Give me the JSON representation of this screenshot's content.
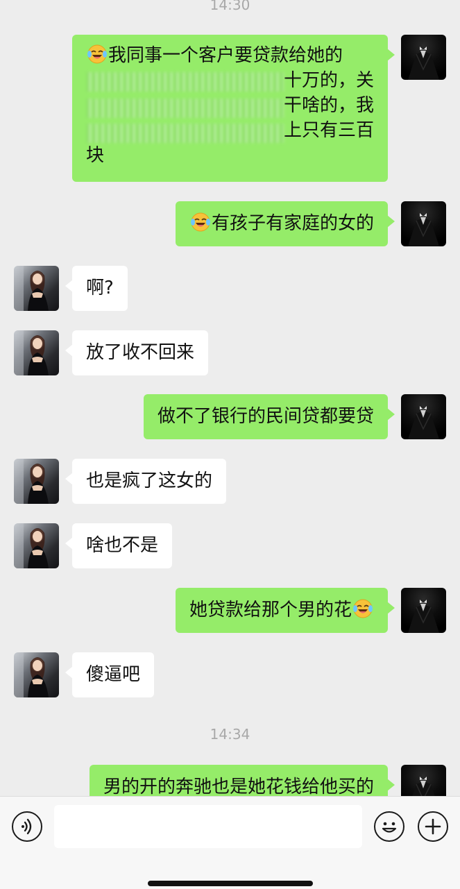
{
  "chat": {
    "timestamps": [
      "14:30",
      "14:34"
    ],
    "messages": [
      {
        "from": "me",
        "lines": [
          "我同事一个客户要贷款给她的",
          "十万的，关",
          "干啥的，我",
          "上只有三百",
          "块"
        ],
        "leading_emoji": "crying-laughing-emoji"
      },
      {
        "from": "me",
        "text": "有孩子有家庭的女的",
        "leading_emoji": "crying-laughing-emoji"
      },
      {
        "from": "peer",
        "text": "啊?"
      },
      {
        "from": "peer",
        "text": "放了收不回来"
      },
      {
        "from": "me",
        "text": "做不了银行的民间贷都要贷"
      },
      {
        "from": "peer",
        "text": "也是疯了这女的"
      },
      {
        "from": "peer",
        "text": "啥也不是"
      },
      {
        "from": "me",
        "text": "她贷款给那个男的花",
        "trailing_emoji": "crying-laughing-emoji"
      },
      {
        "from": "peer",
        "text": "傻逼吧"
      },
      {
        "from": "me",
        "text": "男的开的奔驰也是她花钱给他买的"
      }
    ]
  },
  "toolbar": {
    "input_placeholder": "",
    "icons": [
      "voice-icon",
      "emoji-icon",
      "plus-icon"
    ]
  },
  "colors": {
    "background": "#ededed",
    "outgoing_bubble": "#95ec69",
    "incoming_bubble": "#ffffff"
  }
}
